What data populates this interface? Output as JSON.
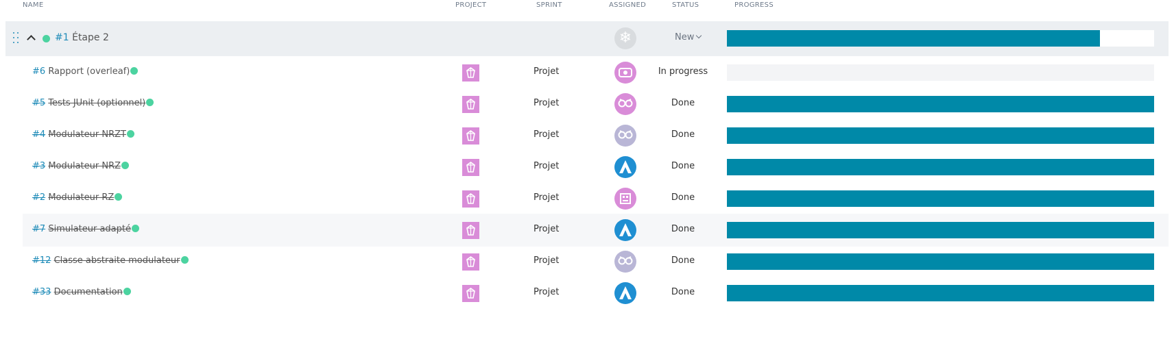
{
  "columns": {
    "name": "NAME",
    "project": "PROJECT",
    "sprint": "SPRINT",
    "assigned": "ASSIGNED",
    "status": "STATUS",
    "progress": "PROGRESS"
  },
  "parent": {
    "ref": "#1",
    "title": "Étape 2",
    "status": "New",
    "progress": 0.873,
    "icons": {
      "drag": "drag-handle-icon",
      "collapse": "chevron-up-icon",
      "status_dot": "green-dot-icon",
      "avatar": "snowflake-avatar-icon",
      "status_dropdown": "chevron-down-icon"
    }
  },
  "rows": [
    {
      "ref": "#6",
      "title": "Rapport (overleaf)",
      "sprint": "Projet",
      "status": "In progress",
      "progress": 0.0,
      "done": false,
      "avatar": "pink-identicon-avatar"
    },
    {
      "ref": "#5",
      "title": "Tests JUnit (optionnel)",
      "sprint": "Projet",
      "status": "Done",
      "progress": 1.0,
      "done": true,
      "avatar": "pink-owl-avatar"
    },
    {
      "ref": "#4",
      "title": "Modulateur NRZT",
      "sprint": "Projet",
      "status": "Done",
      "progress": 1.0,
      "done": true,
      "avatar": "lavender-owl-avatar"
    },
    {
      "ref": "#3",
      "title": "Modulateur NRZ",
      "sprint": "Projet",
      "status": "Done",
      "progress": 1.0,
      "done": true,
      "avatar": "blue-arch-avatar"
    },
    {
      "ref": "#2",
      "title": "Modulateur RZ",
      "sprint": "Projet",
      "status": "Done",
      "progress": 1.0,
      "done": true,
      "avatar": "pink-pixel-avatar"
    },
    {
      "ref": "#7",
      "title": "Simulateur adapté",
      "sprint": "Projet",
      "status": "Done",
      "progress": 1.0,
      "done": true,
      "avatar": "blue-arch-avatar"
    },
    {
      "ref": "#12",
      "title": "Classe abstraite modulateur",
      "sprint": "Projet",
      "status": "Done",
      "progress": 1.0,
      "done": true,
      "avatar": "lavender-owl-avatar"
    },
    {
      "ref": "#33",
      "title": "Documentation",
      "sprint": "Projet",
      "status": "Done",
      "progress": 1.0,
      "done": true,
      "avatar": "blue-arch-avatar"
    }
  ],
  "colors": {
    "accent": "#0089a8",
    "status_dot": "#4cd3a0",
    "project_icon": "#d98cd8",
    "link": "#1e8bb8"
  }
}
